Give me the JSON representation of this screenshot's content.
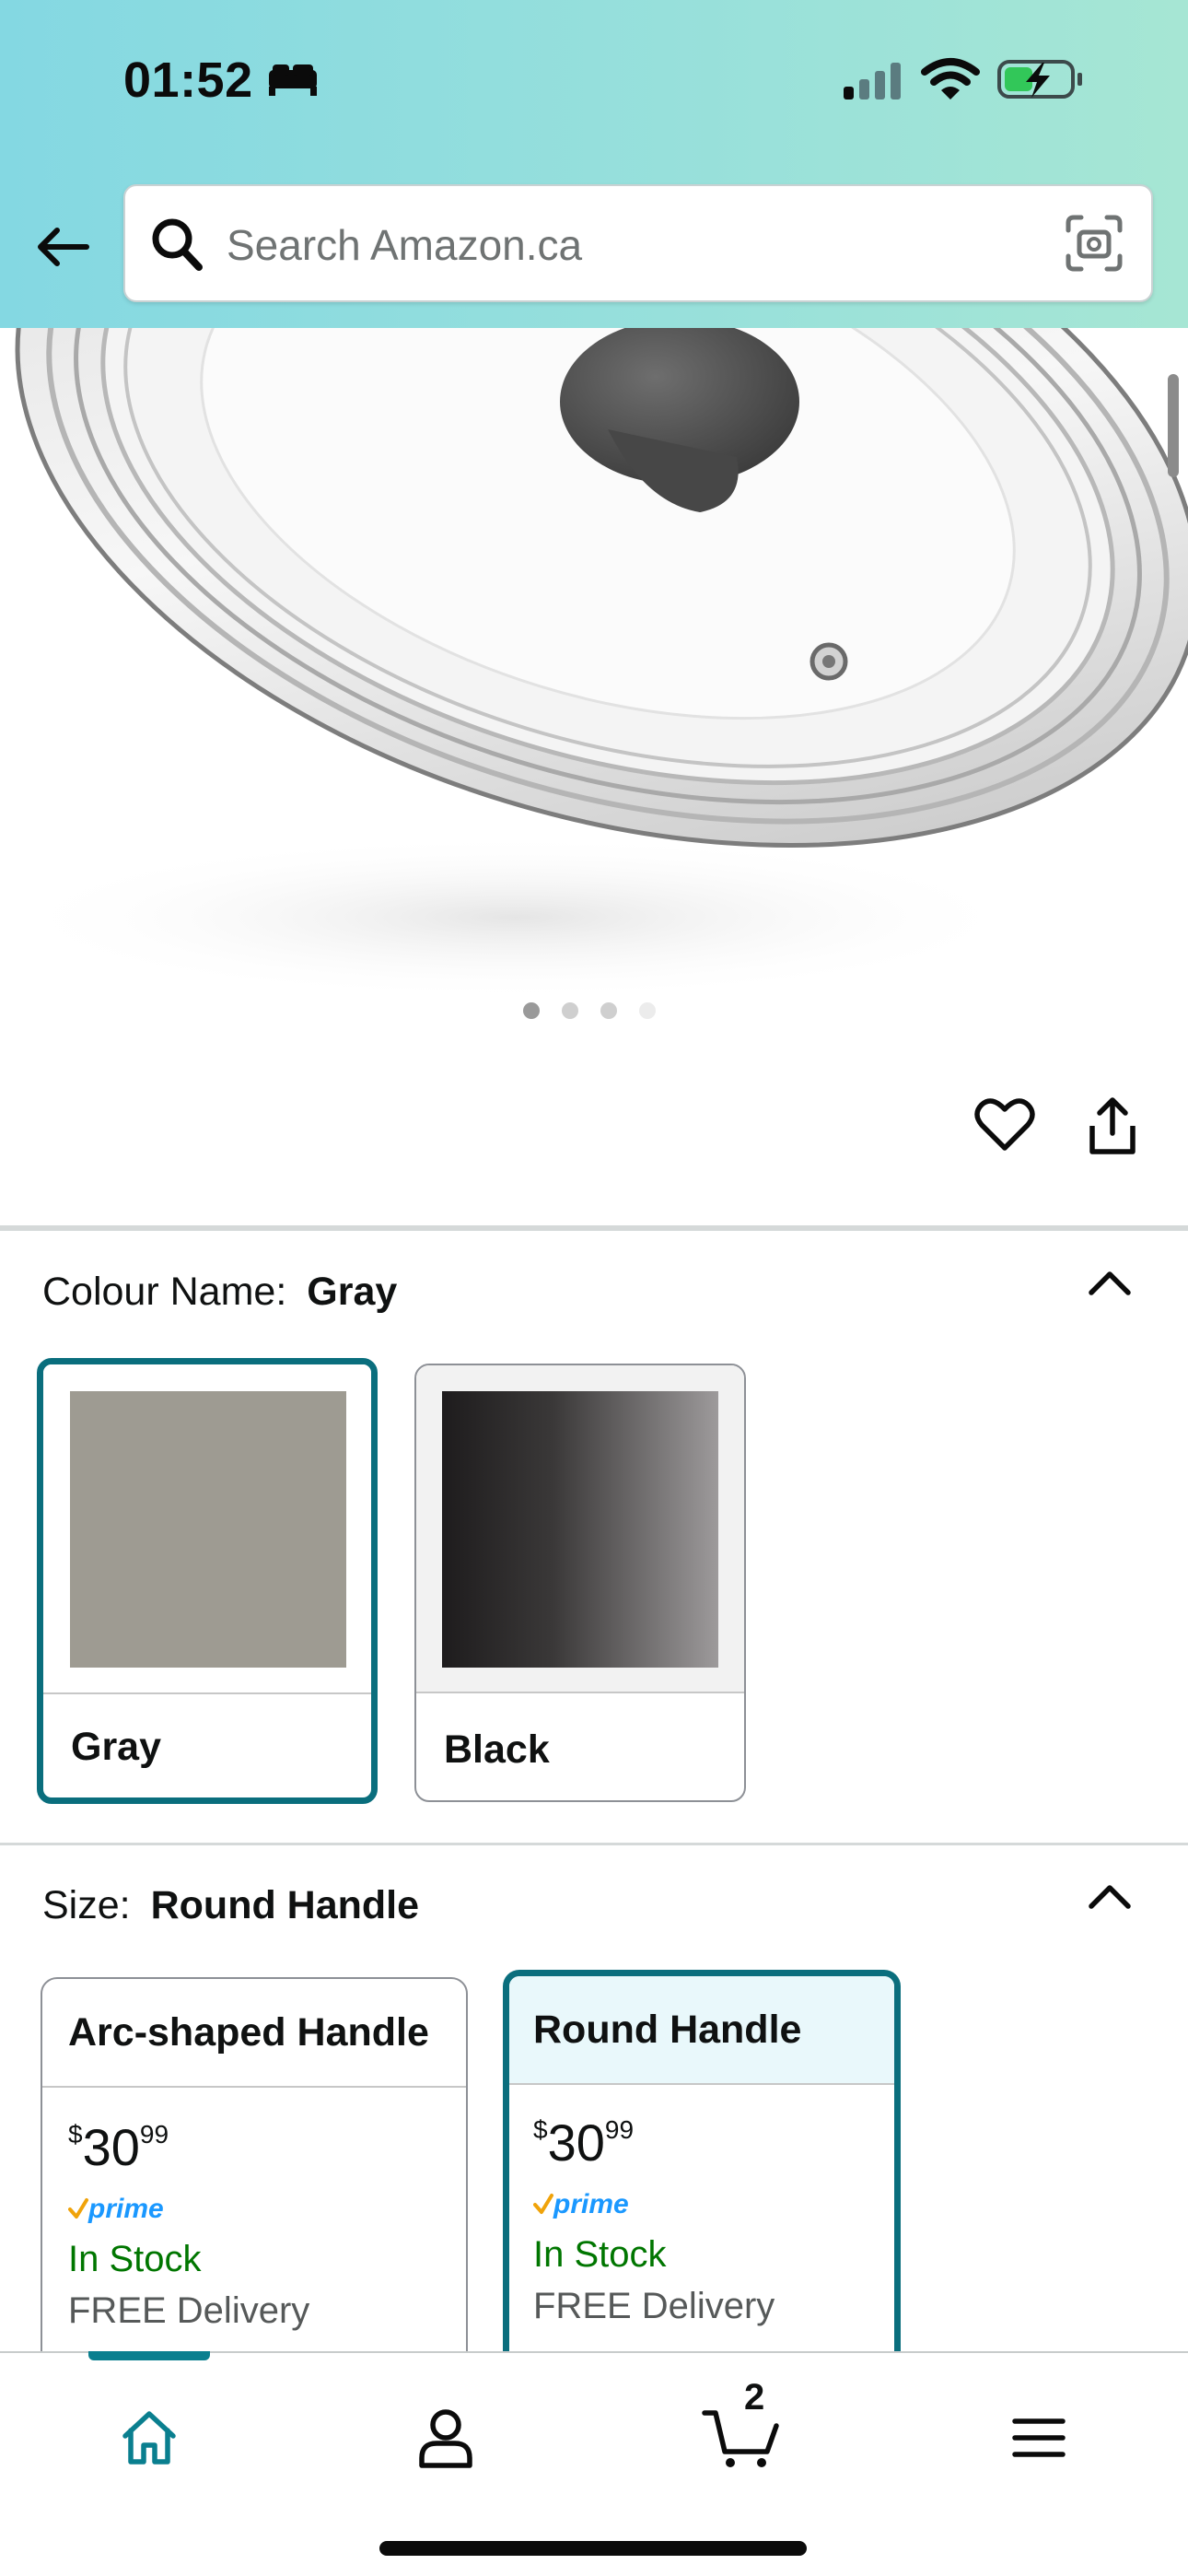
{
  "status_bar": {
    "time": "01:52",
    "icons": [
      "sleep-focus-icon",
      "cellular-signal-icon",
      "wifi-icon",
      "battery-charging-icon"
    ]
  },
  "header": {
    "back_icon": "arrow-left-icon",
    "search": {
      "placeholder": "Search Amazon.ca",
      "value": ""
    },
    "camera_icon": "camera-scan-icon"
  },
  "product_image": {
    "description_icon": "glass-pot-lid-image",
    "carousel_dots": 4,
    "active_dot": 0
  },
  "actions": {
    "wishlist_icon": "heart-icon",
    "share_icon": "share-icon"
  },
  "colour": {
    "label": "Colour Name:",
    "selected": "Gray",
    "options": [
      {
        "name": "Gray",
        "color": "#9e9b92",
        "selected": true
      },
      {
        "name": "Black",
        "color_from": "#1e1c1d",
        "color_to": "#9d9a9b",
        "selected": false
      }
    ]
  },
  "size": {
    "label": "Size:",
    "selected": "Round Handle",
    "options": [
      {
        "name": "Arc-shaped Handle",
        "price_symbol": "$",
        "price_whole": "30",
        "price_fraction": "99",
        "prime": "prime",
        "stock": "In Stock",
        "delivery": "FREE Delivery",
        "selected": false
      },
      {
        "name": "Round Handle",
        "price_symbol": "$",
        "price_whole": "30",
        "price_fraction": "99",
        "prime": "prime",
        "stock": "In Stock",
        "delivery": "FREE Delivery",
        "selected": true
      }
    ]
  },
  "bottom_nav": {
    "items": [
      "home-icon",
      "account-icon",
      "cart-icon",
      "menu-icon"
    ],
    "active": "home",
    "cart_count": "2"
  },
  "colors": {
    "header_gradient_start": "#84d8e2",
    "header_gradient_end": "#a6e6d4",
    "selection_border": "#0a6e7d",
    "in_stock": "#007600",
    "prime_blue": "#1a98ff",
    "prime_check": "#f0a30a"
  }
}
